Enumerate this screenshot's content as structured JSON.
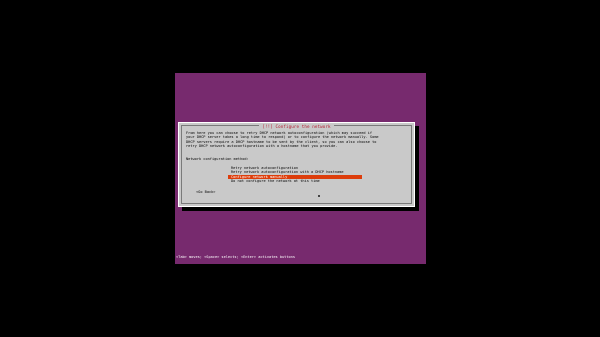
{
  "dialog": {
    "title": "[!!] Configure the network",
    "description_lines": [
      "From here you can choose to retry DHCP network autoconfiguration (which may succeed if",
      "your DHCP server takes a long time to respond) or to configure the network manually. Some",
      "DHCP servers require a DHCP hostname to be sent by the client, so you can also choose to",
      "retry DHCP network autoconfiguration with a hostname that you provide."
    ],
    "prompt": "Network configuration method:",
    "options": [
      "Retry network autoconfiguration",
      "Retry network autoconfiguration with a DHCP hostname",
      "Configure network manually",
      "Do not configure the network at this time"
    ],
    "selected_index": 2,
    "back_button": "<Go Back>"
  },
  "status_line": "<Tab> moves; <Space> selects; <Enter> activates buttons",
  "colors": {
    "console_background": "#772a6e",
    "dialog_background": "#c9c9c9",
    "title_text": "#b5182b",
    "selection_highlight": "#dd3d0b",
    "screen_background": "#000000"
  }
}
